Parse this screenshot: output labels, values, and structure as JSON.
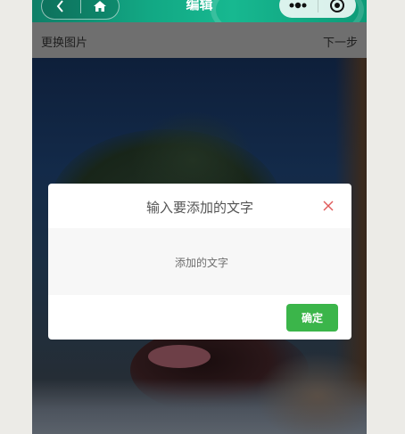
{
  "navbar": {
    "title": "编辑",
    "back_icon": "chevron-left-icon",
    "home_icon": "home-icon",
    "more_icon": "more-dots-icon",
    "capture_icon": "record-icon"
  },
  "toolbar": {
    "replace_label": "更换图片",
    "next_label": "下一步"
  },
  "dialog": {
    "title": "输入要添加的文字",
    "input_value": "",
    "input_placeholder": "添加的文字",
    "confirm_label": "确定",
    "close_icon": "close-icon"
  },
  "colors": {
    "navbar_green": "#12a884",
    "confirm_green": "#3bb54a",
    "close_red": "#e05a5a"
  }
}
